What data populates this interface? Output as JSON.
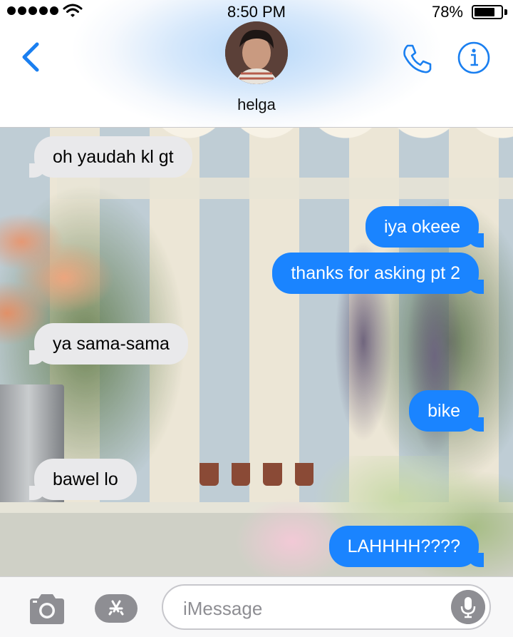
{
  "status_bar": {
    "time": "8:50 PM",
    "battery_percent": "78%",
    "battery_level": 0.78,
    "signal_bars": 5
  },
  "header": {
    "contact_name": "helga",
    "back_icon": "chevron-left-icon",
    "call_icon": "phone-icon",
    "info_icon": "info-icon",
    "accent_color": "#1a7ff0"
  },
  "messages": [
    {
      "direction": "incoming",
      "text": "oh yaudah kl gt"
    },
    {
      "direction": "outgoing",
      "text": "iya okeee"
    },
    {
      "direction": "outgoing",
      "text": "thanks for asking pt 2"
    },
    {
      "direction": "incoming",
      "text": "ya sama-sama"
    },
    {
      "direction": "outgoing",
      "text": "bike"
    },
    {
      "direction": "incoming",
      "text": "bawel lo"
    },
    {
      "direction": "outgoing",
      "text": "LAHHHH????"
    }
  ],
  "composer": {
    "placeholder": "iMessage",
    "camera_icon": "camera-icon",
    "apps_icon": "app-store-icon",
    "mic_icon": "microphone-icon"
  },
  "colors": {
    "outgoing_bubble": "#1a84ff",
    "incoming_bubble": "#e9e9eb"
  }
}
